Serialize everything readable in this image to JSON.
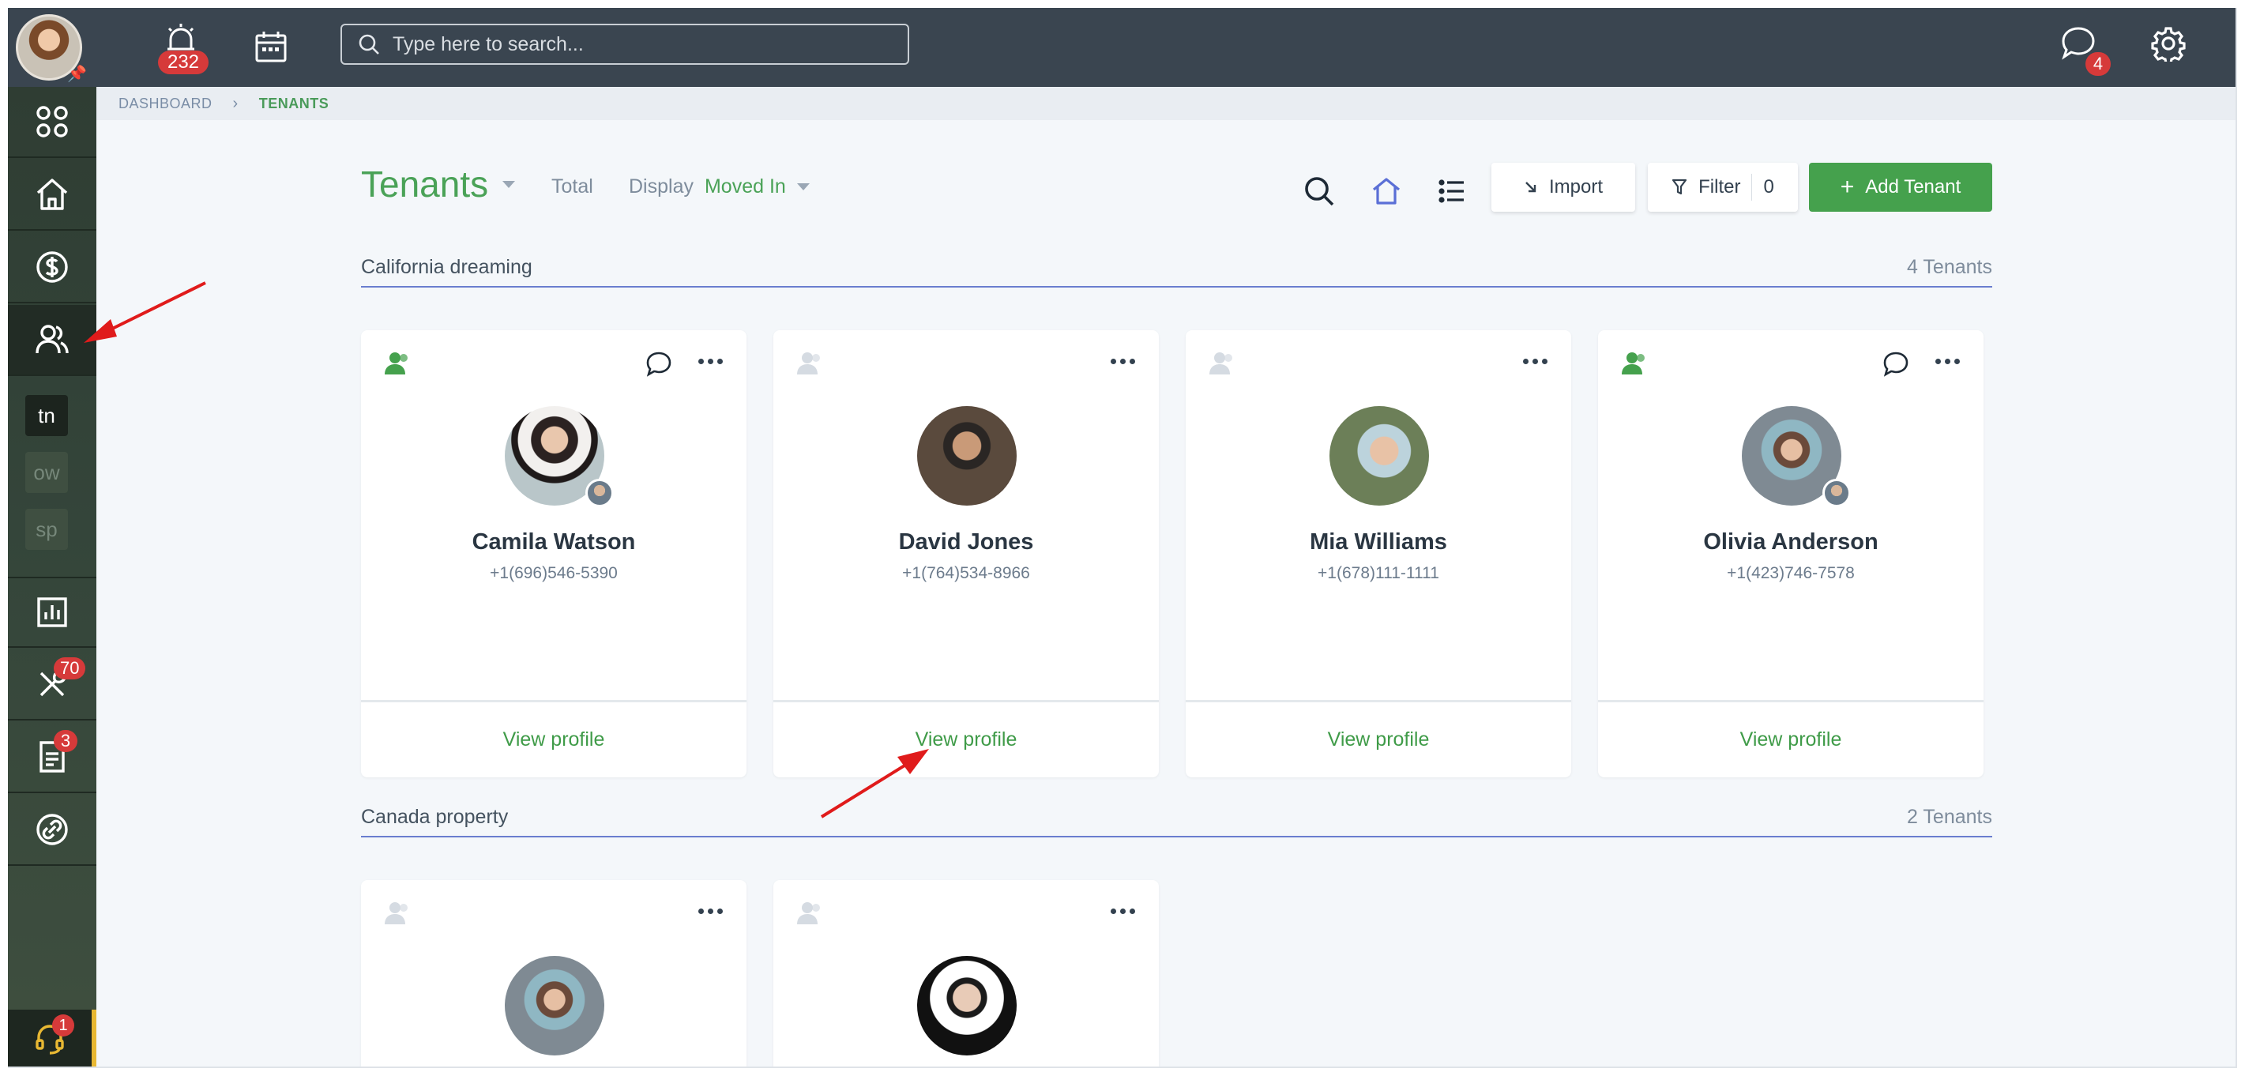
{
  "topbar": {
    "alarm_count": "232",
    "search_placeholder": "Type here to search...",
    "messages_count": "4"
  },
  "sidebar": {
    "items": [
      {
        "icon": "grid-icon"
      },
      {
        "icon": "home-icon"
      },
      {
        "icon": "dollar-icon"
      },
      {
        "icon": "users-icon",
        "active": true
      },
      {
        "label": "tn"
      },
      {
        "label": "ow"
      },
      {
        "label": "sp"
      },
      {
        "icon": "bar-chart-icon"
      },
      {
        "icon": "tools-icon",
        "badge": "70"
      },
      {
        "icon": "document-icon",
        "badge": "3"
      },
      {
        "icon": "link-icon"
      }
    ],
    "support_badge": "1"
  },
  "breadcrumb": {
    "parent": "DASHBOARD",
    "current": "TENANTS"
  },
  "header": {
    "title": "Tenants",
    "total_label": "Total",
    "display_label": "Display",
    "display_value": "Moved In",
    "import_label": "Import",
    "filter_label": "Filter",
    "filter_count": "0",
    "add_label": "Add Tenant"
  },
  "groups": [
    {
      "name": "California dreaming",
      "count": "4 Tenants",
      "tenants": [
        {
          "name": "Camila Watson",
          "phone": "+1(696)546-5390",
          "action": "View profile"
        },
        {
          "name": "David Jones",
          "phone": "+1(764)534-8966",
          "action": "View profile"
        },
        {
          "name": "Mia Williams",
          "phone": "+1(678)111-1111",
          "action": "View profile"
        },
        {
          "name": "Olivia Anderson",
          "phone": "+1(423)746-7578",
          "action": "View profile"
        }
      ]
    },
    {
      "name": "Canada property",
      "count": "2 Tenants",
      "tenants": []
    }
  ],
  "colors": {
    "topbar": "#3a4550",
    "sidebar": "#2f3d33",
    "accent_green": "#45a14d",
    "annotation_red": "#e01b1b"
  }
}
